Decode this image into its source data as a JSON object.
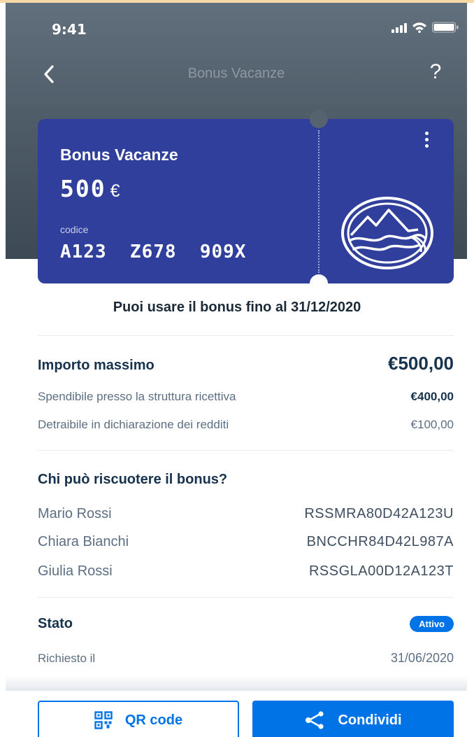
{
  "status_bar": {
    "time": "9:41"
  },
  "nav": {
    "title": "Bonus Vacanze",
    "help_label": "?"
  },
  "card": {
    "title": "Bonus Vacanze",
    "amount": "500",
    "currency": "€",
    "code_label": "codice",
    "code": "A123  Z678  909X"
  },
  "validity": "Puoi usare il bonus fino al 31/12/2020",
  "amounts": {
    "max_label": "Importo massimo",
    "max_value": "€500,00",
    "rows": [
      {
        "label": "Spendibile presso la struttura ricettiva",
        "value": "€400,00"
      },
      {
        "label": "Detraibile in dichiarazione dei redditi",
        "value": "€100,00"
      }
    ]
  },
  "beneficiaries": {
    "title": "Chi può riscuotere il bonus?",
    "people": [
      {
        "name": "Mario Rossi",
        "cf": "RSSMRA80D42A123U"
      },
      {
        "name": "Chiara Bianchi",
        "cf": "BNCCHR84D42L987A"
      },
      {
        "name": "Giulia Rossi",
        "cf": "RSSGLA00D12A123T"
      }
    ]
  },
  "status": {
    "label": "Stato",
    "badge": "Attivo",
    "requested_label": "Richiesto il",
    "requested_date": "31/06/2020"
  },
  "actions": {
    "qr_label": "QR code",
    "share_label": "Condividi"
  },
  "colors": {
    "primary": "#0073e6",
    "card": "#2f3f9b",
    "header": "#4f5d69",
    "text": "#17324d"
  },
  "icons": [
    "back-arrow-icon",
    "help-icon",
    "kebab-menu-icon",
    "bonus-vacanze-logo",
    "qr-code-icon",
    "share-icon",
    "signal-icon",
    "wifi-icon",
    "battery-icon"
  ]
}
